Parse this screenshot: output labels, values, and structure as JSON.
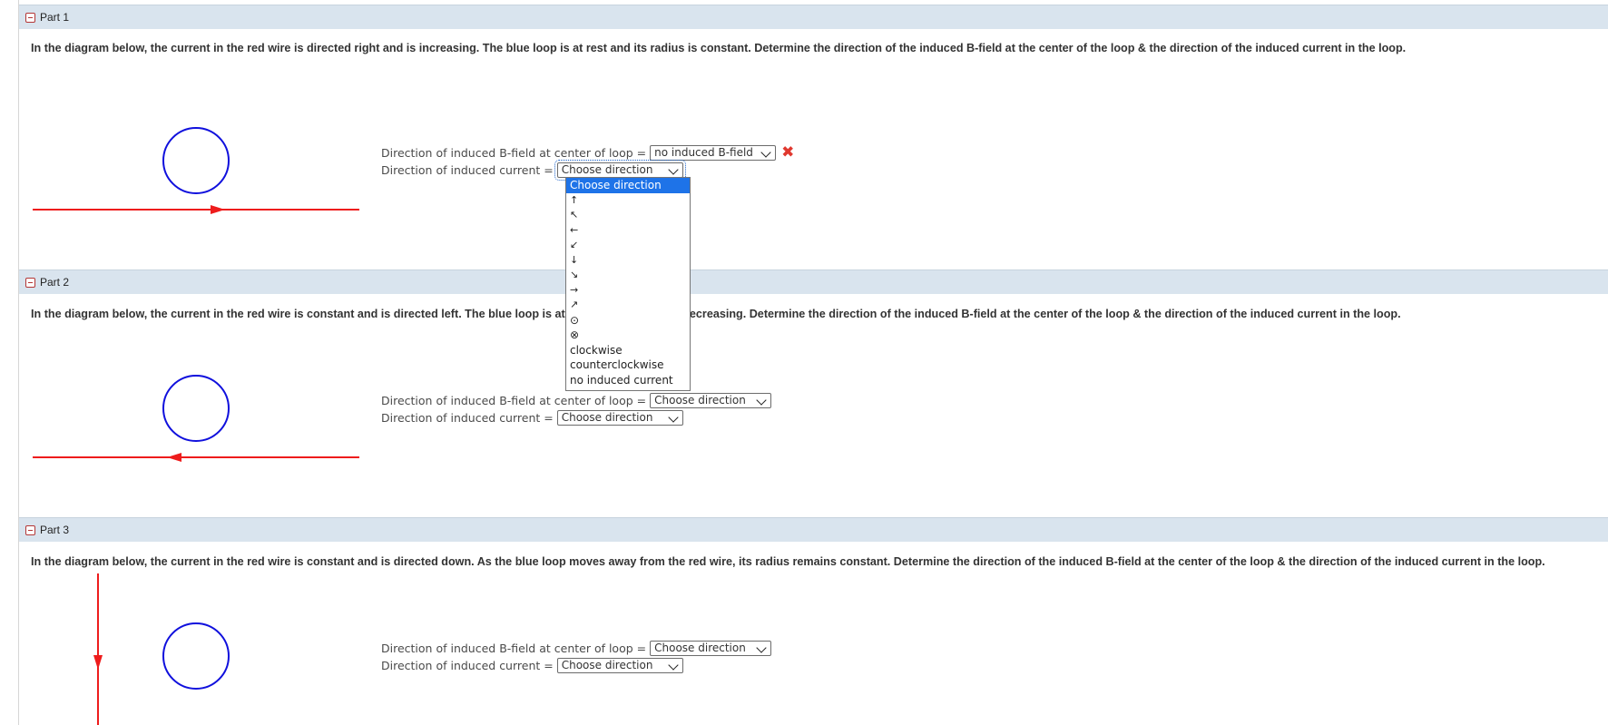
{
  "parts": [
    {
      "title": "Part 1",
      "question": "In the diagram below, the current in the red wire is directed right and is increasing. The blue loop is at rest and its radius is constant. Determine the direction of the induced B-field at the center of the loop & the direction of the induced current in the loop.",
      "bfield_label": "Direction of induced B-field at center of loop =",
      "bfield_value": "no induced B-field",
      "bfield_status": "✖",
      "current_label": "Direction of induced current =",
      "current_value": "Choose direction"
    },
    {
      "title": "Part 2",
      "question": "In the diagram below, the current in the red wire is constant and is directed left. The blue loop is at rest and its radius is decreasing. Determine the direction of the induced B-field at the center of the loop & the direction of the induced current in the loop.",
      "bfield_label": "Direction of induced B-field at center of loop =",
      "bfield_value": "Choose direction",
      "current_label": "Direction of induced current =",
      "current_value": "Choose direction"
    },
    {
      "title": "Part 3",
      "question": "In the diagram below, the current in the red wire is constant and is directed down. As the blue loop moves away from the red wire, its radius remains constant. Determine the direction of the induced B-field at the center of the loop & the direction of the induced current in the loop.",
      "bfield_label": "Direction of induced B-field at center of loop =",
      "bfield_value": "Choose direction",
      "current_label": "Direction of induced current =",
      "current_value": "Choose direction"
    }
  ],
  "dropdown": {
    "options": [
      "Choose direction",
      "↑",
      "↖",
      "←",
      "↙",
      "↓",
      "↘",
      "→",
      "↗",
      "⊙",
      "⊗",
      "clockwise",
      "counterclockwise",
      "no induced current"
    ],
    "selected_index": 0
  },
  "colors": {
    "wire": "#ee1c1c",
    "loop": "#1010dd",
    "header_bg": "#d9e4ee",
    "selected_option": "#1e73e8"
  }
}
